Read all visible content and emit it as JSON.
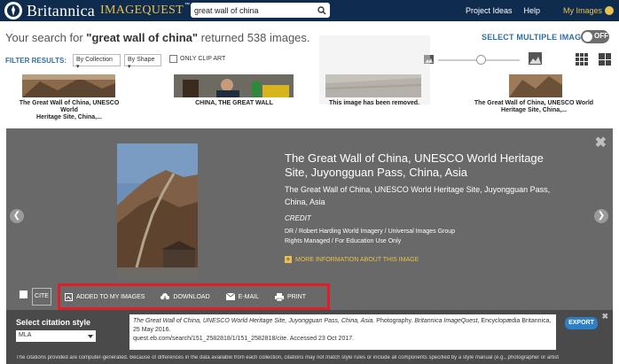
{
  "header": {
    "brand": "Britannica",
    "product": "IMAGEQUEST",
    "tm": "™",
    "search_value": "great wall of china",
    "links": {
      "project_ideas": "Project Ideas",
      "help": "Help",
      "my_images": "My Images"
    }
  },
  "summary": {
    "prefix": "Your search for ",
    "query": "\"great wall of china\"",
    "suffix": " returned 538 images."
  },
  "select_multiple": {
    "label": "SELECT MULTIPLE IMAGES",
    "state": "OFF"
  },
  "filters": {
    "label": "FILTER RESULTS:",
    "collection": "By Collection",
    "shape": "By Shape",
    "clip_art": "ONLY CLIP ART"
  },
  "thumbnails": [
    {
      "caption_line1": "The Great Wall of China, UNESCO World",
      "caption_line2": "Heritage Site, China,..."
    },
    {
      "caption_line1": "CHINA, THE GREAT WALL",
      "caption_line2": ""
    },
    {
      "caption_line1": "This image has been removed.",
      "caption_line2": ""
    },
    {
      "caption_line1": "The Great Wall of China, UNESCO World",
      "caption_line2": "Heritage Site, China,..."
    }
  ],
  "detail": {
    "title": "The Great Wall of China, UNESCO World Heritage Site, Juyongguan Pass, China, Asia",
    "subtitle": "The Great Wall of China, UNESCO World Heritage Site, Juyongguan Pass, China, Asia",
    "credit_label": "CREDIT",
    "credit_line1": "DR / Robert Harding World Imagery / Universal Images Group",
    "credit_line2": "Rights Managed / For Education Use Only",
    "more_info": "MORE INFORMATION ABOUT THIS IMAGE"
  },
  "actions": {
    "cite": "CITE",
    "added": "ADDED TO MY IMAGES",
    "download": "DOWNLOAD",
    "email": "E-MAIL",
    "print": "PRINT"
  },
  "citation": {
    "label": "Select citation style",
    "style": "MLA",
    "text_italic": "The Great Wall of China, UNESCO World Heritage Site, Juyongguan Pass, China, Asia.",
    "text_plain1": " Photography. ",
    "text_italic2": "Britannica ImageQuest",
    "text_plain2": ", Encyclopædia Britannica, 25 May 2016.",
    "text_url": "quest.eb.com/search/151_2582818/1/151_2582818/cite. Accessed 23 Oct 2017.",
    "export": "EXPORT",
    "disclaimer": "The citations provided are computer-generated. Because of differences in the data available from each collection, citations may not match style rules or include all components specified by a style manual (e.g., photographer or artist"
  },
  "colors": {
    "header_bg": "#0f2c4e",
    "accent_gold": "#e9c14b",
    "link_blue": "#2f6fa8",
    "panel_gray": "#696969",
    "highlight_red": "#e21d2a"
  }
}
